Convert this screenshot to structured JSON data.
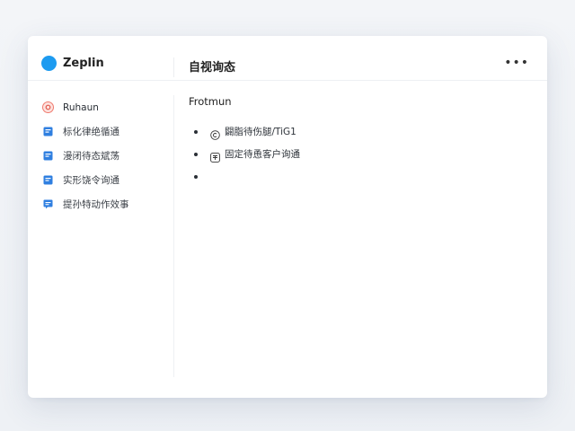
{
  "app": {
    "name": "Zeplin",
    "brand_color": "#1d9bf0"
  },
  "header": {
    "title": "自视询态",
    "more_label": "•••"
  },
  "sidebar": {
    "items": [
      {
        "label": "Ruhaun",
        "icon": "target-icon"
      },
      {
        "label": "标化律绝循通",
        "icon": "doc-icon"
      },
      {
        "label": "漫闭待态斌荡",
        "icon": "doc-icon"
      },
      {
        "label": "实形饶令询通",
        "icon": "doc-icon"
      },
      {
        "label": "提孙特动作效事",
        "icon": "chat-icon"
      }
    ]
  },
  "main": {
    "section_title": "Frotmun",
    "bullets": [
      {
        "text": "闢脂待伤腿/TiG1",
        "icon": "copyright-icon"
      },
      {
        "text": "固定待恿客户询通",
        "icon": "badge-icon"
      },
      {
        "text": "",
        "icon": ""
      }
    ]
  }
}
